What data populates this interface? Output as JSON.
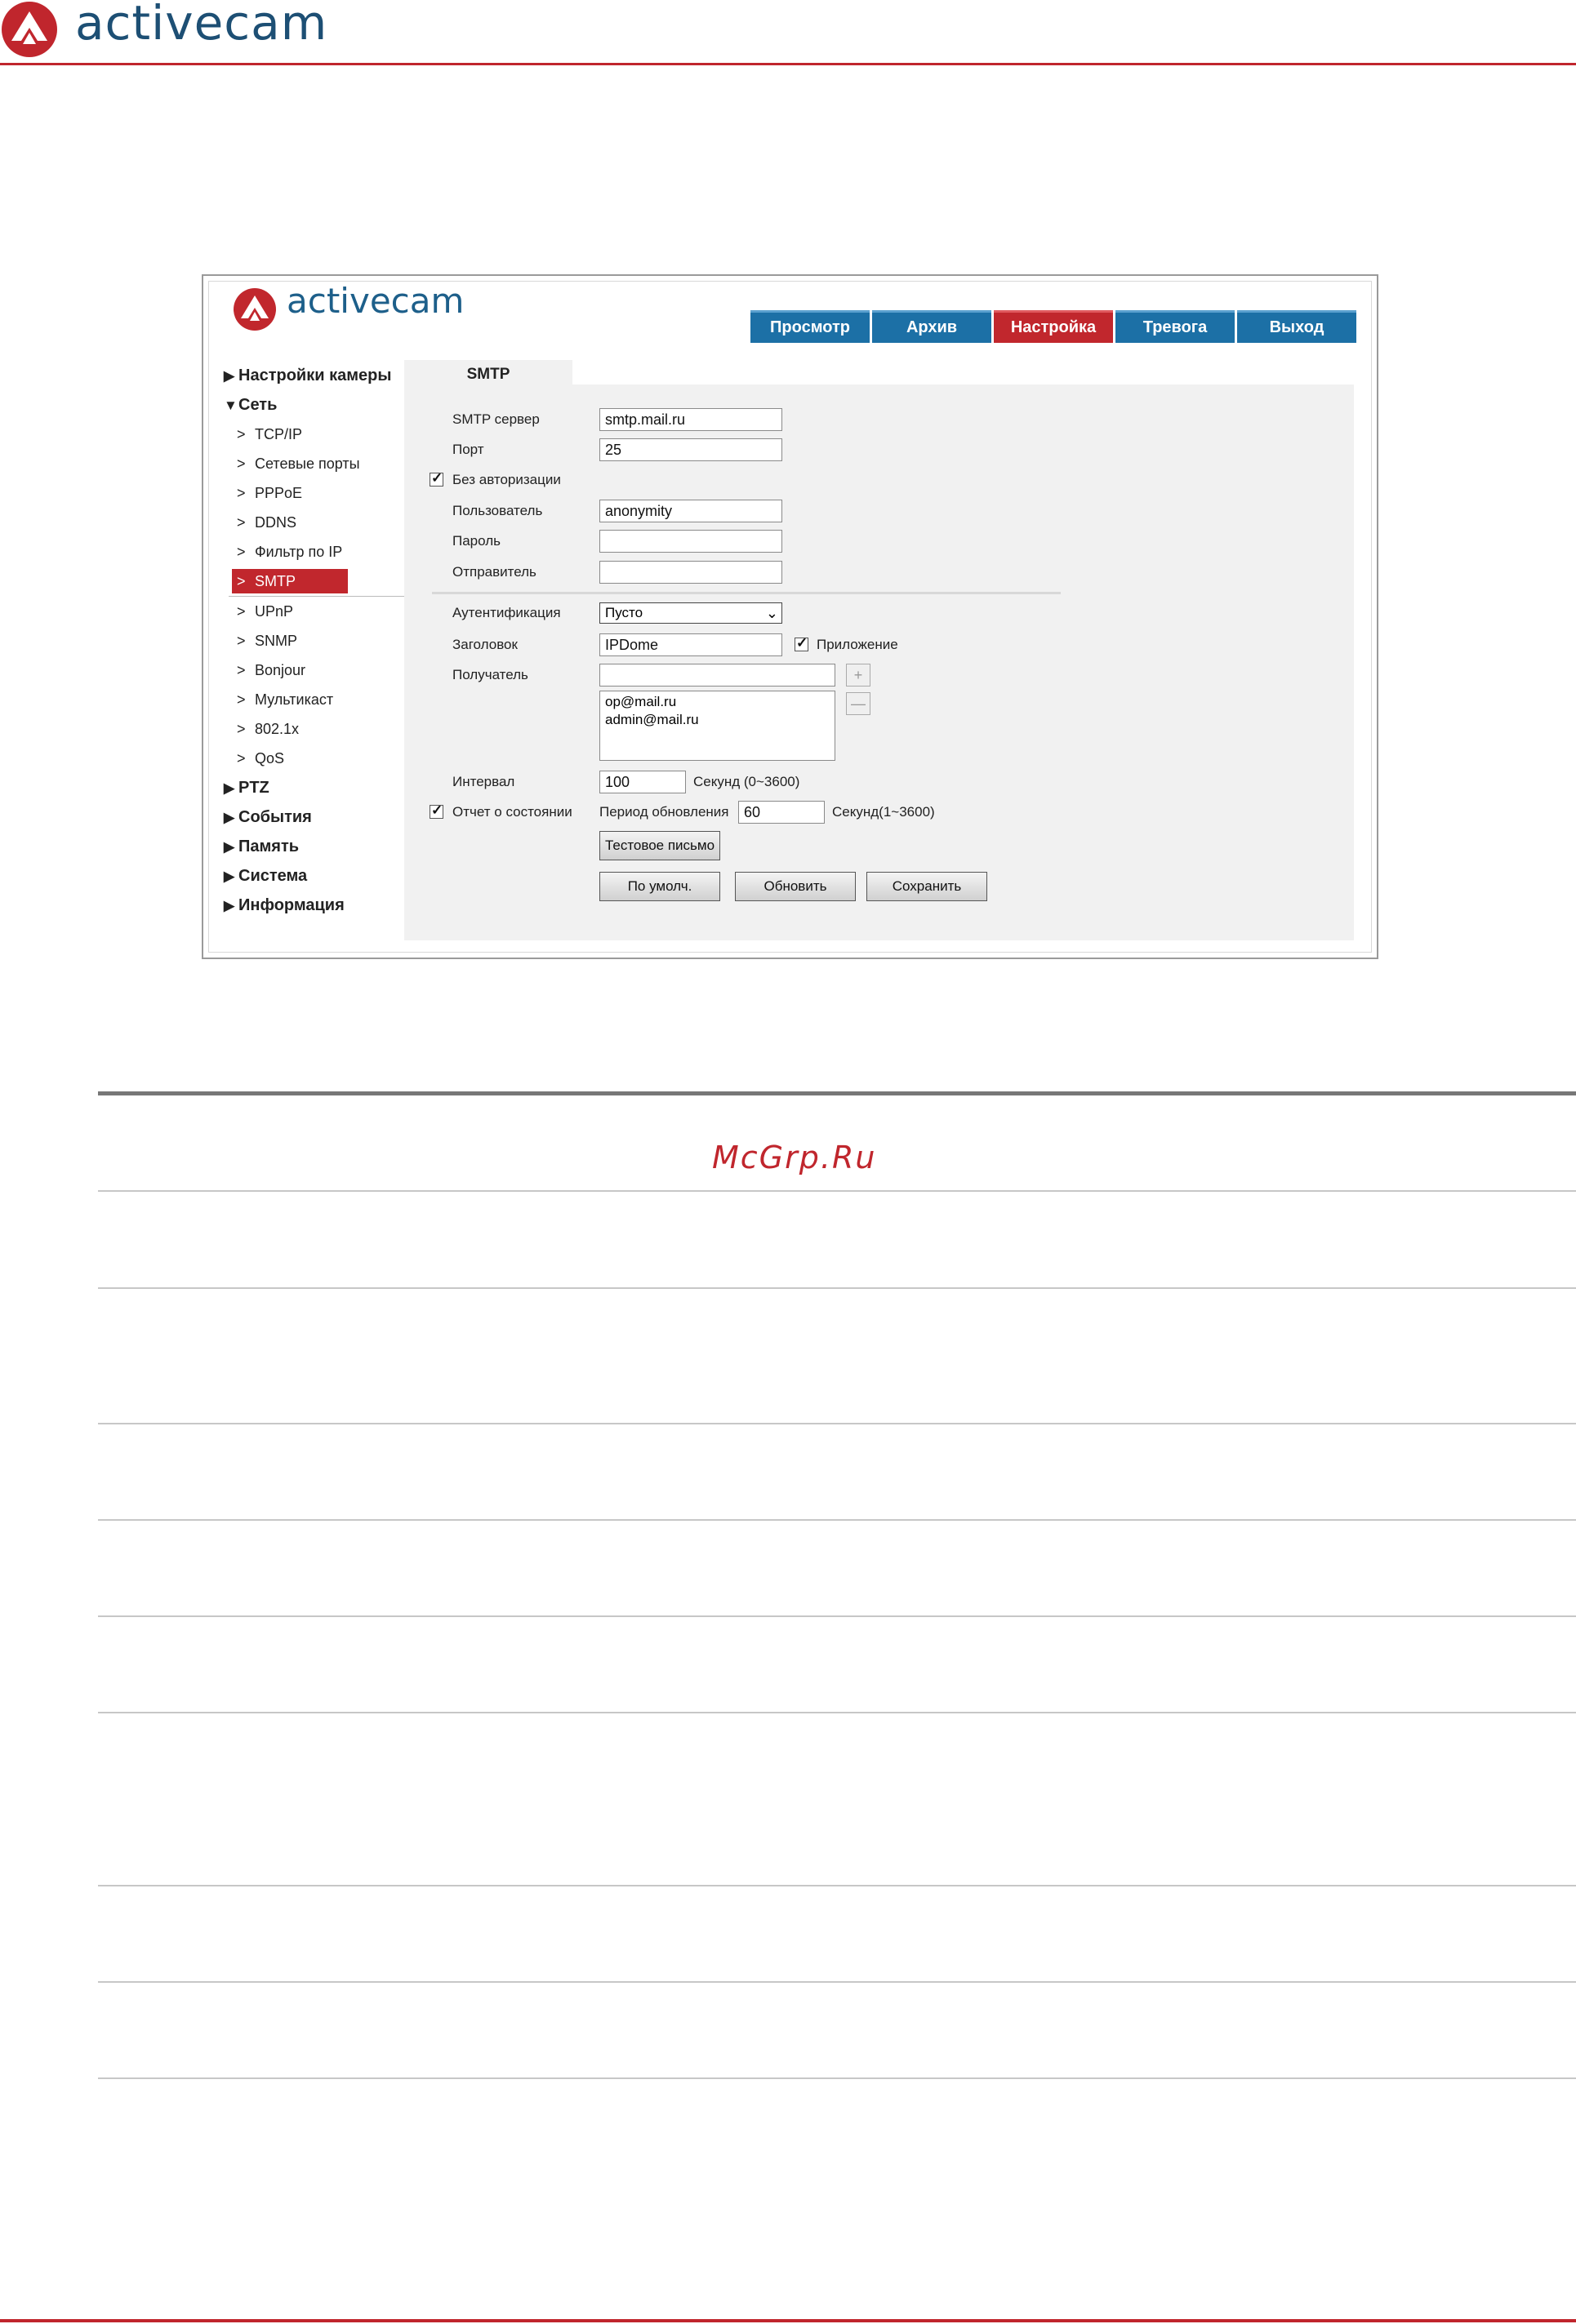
{
  "header": {
    "brand": "activecam"
  },
  "screenshot": {
    "brand": "activecam",
    "tabs": [
      {
        "label": "Просмотр"
      },
      {
        "label": "Архив"
      },
      {
        "label": "Настройка"
      },
      {
        "label": "Тревога"
      },
      {
        "label": "Выход"
      }
    ],
    "sidebar": {
      "camera_settings": "Настройки камеры",
      "network": "Сеть",
      "items": [
        "TCP/IP",
        "Сетевые порты",
        "PPPoE",
        "DDNS",
        "Фильтр по IP",
        "SMTP",
        "UPnP",
        "SNMP",
        "Bonjour",
        "Мультикаст",
        "802.1x",
        "QoS"
      ],
      "groups_after": [
        "PTZ",
        "События",
        "Память",
        "Система",
        "Информация"
      ]
    },
    "content_tab": "SMTP",
    "form": {
      "smtp_server_label": "SMTP сервер",
      "smtp_server_value": "smtp.mail.ru",
      "port_label": "Порт",
      "port_value": "25",
      "no_auth_label": "Без авторизации",
      "user_label": "Пользователь",
      "user_value": "anonymity",
      "password_label": "Пароль",
      "sender_label": "Отправитель",
      "auth_label": "Аутентификация",
      "auth_value": "Пусто",
      "subject_label": "Заголовок",
      "subject_value": "IPDome",
      "attachment_label": "Приложение",
      "recipient_label": "Получатель",
      "recipients": [
        "op@mail.ru",
        "admin@mail.ru"
      ],
      "add_symbol": "+",
      "remove_symbol": "—",
      "interval_label": "Интервал",
      "interval_value": "100",
      "interval_unit": "Секунд (0~3600)",
      "status_report_label": "Отчет о состоянии",
      "update_period_label": "Период обновления",
      "update_period_value": "60",
      "update_period_unit": "Секунд(1~3600)",
      "test_button": "Тестовое письмо",
      "default_button": "По умолч.",
      "refresh_button": "Обновить",
      "save_button": "Сохранить"
    }
  },
  "watermark": "McGrp.Ru",
  "colors": {
    "accent_red": "#c0262d",
    "tab_blue": "#1c70a6",
    "brand_blue": "#1d4f74"
  }
}
